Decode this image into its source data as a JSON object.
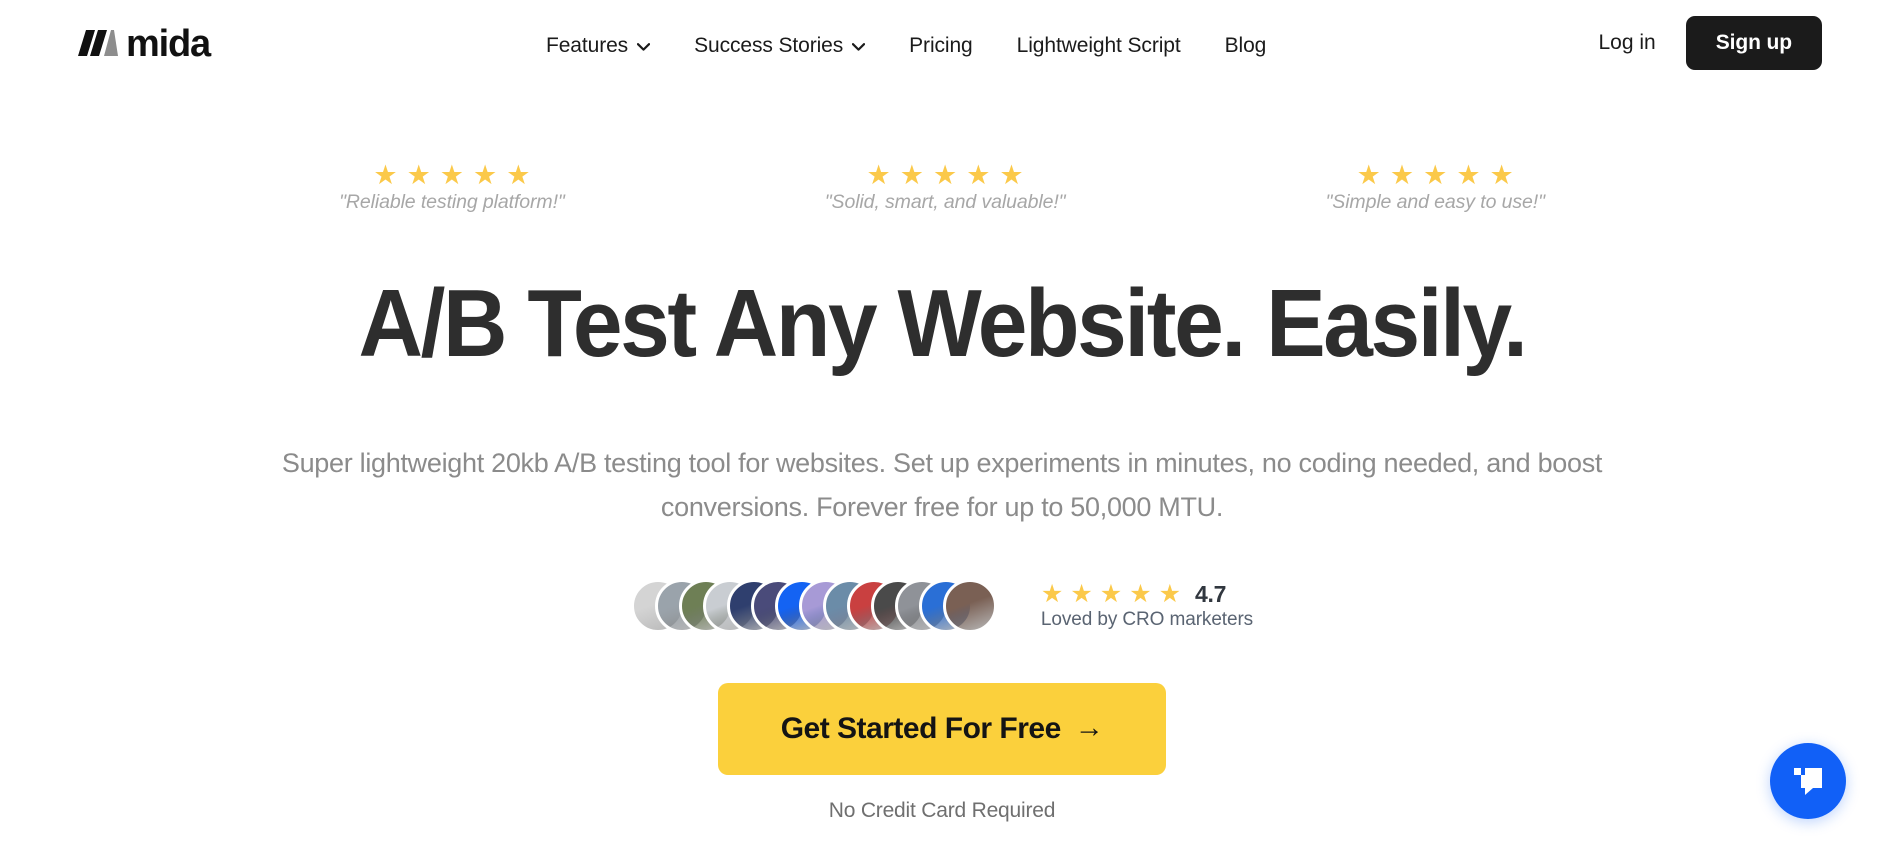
{
  "brand": {
    "logo_text": "mida",
    "logo_icon": "mida-bars-logo"
  },
  "header": {
    "nav_items": [
      {
        "label": "Features",
        "has_dropdown": true
      },
      {
        "label": "Success Stories",
        "has_dropdown": true
      },
      {
        "label": "Pricing",
        "has_dropdown": false
      },
      {
        "label": "Lightweight Script",
        "has_dropdown": false
      },
      {
        "label": "Blog",
        "has_dropdown": false
      }
    ],
    "login_label": "Log in",
    "signup_label": "Sign up"
  },
  "testimonials": [
    {
      "stars": 5,
      "quote": "\"Reliable testing platform!\""
    },
    {
      "stars": 5,
      "quote": "\"Solid, smart, and valuable!\""
    },
    {
      "stars": 5,
      "quote": "\"Simple and easy to use!\""
    }
  ],
  "hero": {
    "headline": "A/B Test Any Website. Easily.",
    "subtitle": "Super lightweight 20kb A/B testing tool for websites. Set up experiments in minutes, no coding needed, and boost conversions. Forever free for up to 50,000 MTU.",
    "cta_label": "Get Started For Free",
    "cta_arrow": "→",
    "cta_note": "No Credit Card Required"
  },
  "social_proof": {
    "avatar_count": 14,
    "avatar_colors": [
      "#d4d4d4",
      "#9aa3ab",
      "#6e7f55",
      "#c9cdd2",
      "#2f3f6e",
      "#4a4b7a",
      "#1463f3",
      "#a79ad6",
      "#6b8ca8",
      "#c94040",
      "#4a4a4a",
      "#8f9298",
      "#2a6fd6",
      "#7a6054"
    ],
    "stars": 5,
    "rating_value": "4.7",
    "rating_caption": "Loved by CRO marketers"
  },
  "chat": {
    "icon": "chat-bubble-icon",
    "color": "#1160F7"
  },
  "colors": {
    "star": "#FBC94A",
    "cta_yellow": "#FBD03C",
    "headline": "#2e2e2e",
    "dark": "#1b1b1b"
  }
}
